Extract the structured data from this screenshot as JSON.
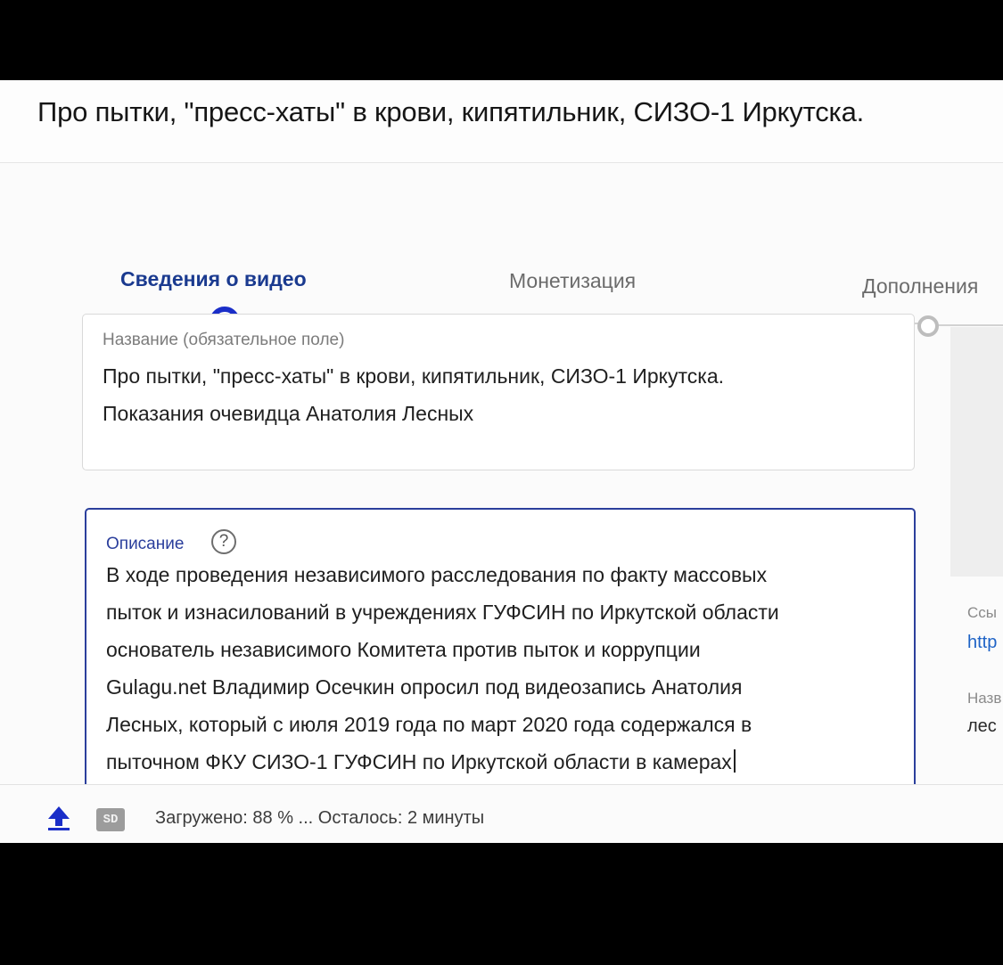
{
  "page": {
    "title": "Про пытки, \"пресс-хаты\" в крови, кипятильник, СИЗО-1 Иркутска."
  },
  "stepper": {
    "steps": [
      {
        "label": "Сведения о видео",
        "state": "active"
      },
      {
        "label": "Монетизация",
        "state": "inactive"
      },
      {
        "label": "Дополнения",
        "state": "inactive"
      }
    ]
  },
  "title_field": {
    "label": "Название (обязательное поле)",
    "value_lines": [
      "Про пытки, \"пресс-хаты\" в крови, кипятильник, СИЗО-1 Иркутска.",
      "Показания очевидца Анатолия Лесных"
    ]
  },
  "description_field": {
    "label": "Описание",
    "help_icon": "?",
    "value_lines": [
      "В ходе проведения независимого расследования по факту массовых",
      "пыток и изнасилований в учреждениях ГУФСИН по Иркутской области",
      "основатель независимого Комитета против пыток и коррупции",
      "Gulagu.net Владимир Осечкин опросил под видеозапись Анатолия",
      "Лесных, который с июля 2019 года по март 2020 года содержался в",
      "пыточном ФКУ СИЗО-1 ГУФСИН по Иркутской области в камерах"
    ]
  },
  "side_panel": {
    "link_label": "Ссы",
    "link_value": "http",
    "filename_label": "Назв",
    "filename_value": "лес"
  },
  "bottom_bar": {
    "sd_badge": "SD",
    "status": "Загружено: 88 % ... Осталось: 2 минуты",
    "progress_percent": 88
  },
  "colors": {
    "accent": "#1a2ec8",
    "active_step_text": "#1a3a8f",
    "link": "#1e63c6",
    "focused_border": "#2b3f9c"
  },
  "icons": {
    "upload": "upload-arrow-icon",
    "help": "help-circle-icon",
    "quality": "sd-quality-icon"
  }
}
